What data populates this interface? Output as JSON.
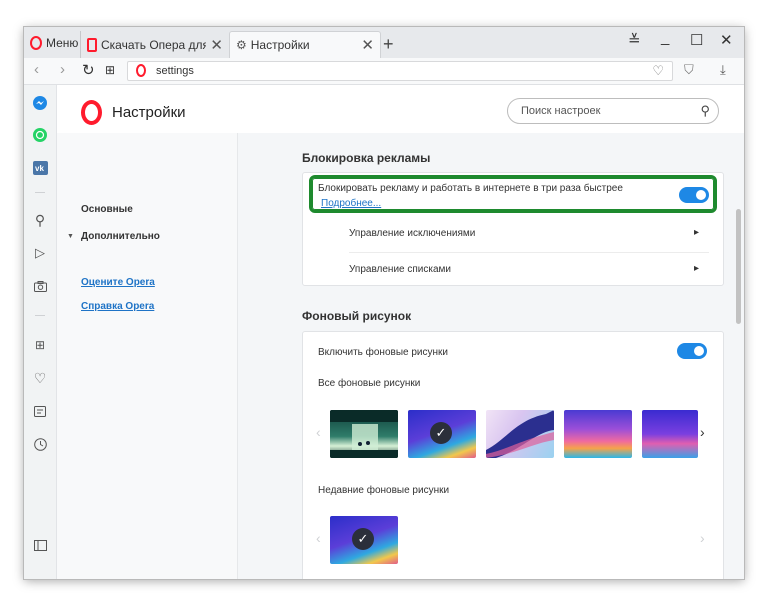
{
  "window": {
    "menu_label": "Меню",
    "tabs": [
      {
        "title": "Скачать Опера для компьютера",
        "icon": "opera-logo-icon"
      },
      {
        "title": "Настройки",
        "icon": "gear-icon"
      }
    ],
    "controls": [
      "tab-menu-icon",
      "minimize-icon",
      "maximize-icon",
      "close-icon"
    ]
  },
  "address_bar": {
    "url": "settings"
  },
  "sidebar": {
    "icons": [
      "messenger-icon",
      "whatsapp-icon",
      "vk-icon",
      "search-icon",
      "send-icon",
      "camera-icon",
      "speed-dial-icon",
      "heart-icon",
      "news-icon",
      "history-icon",
      "sidebar-toggle-icon"
    ]
  },
  "header": {
    "title": "Настройки",
    "search_placeholder": "Поиск настроек"
  },
  "left_nav": {
    "basic": "Основные",
    "advanced": "Дополнительно",
    "rate_link": "Оцените Opera",
    "help_link": "Справка Opera"
  },
  "adblock": {
    "section_title": "Блокировка рекламы",
    "toggle_text": "Блокировать рекламу и работать в интернете в три раза быстрее",
    "more_link": "Подробнее...",
    "enabled": true,
    "exceptions": "Управление исключениями",
    "lists": "Управление списками"
  },
  "wallpaper": {
    "section_title": "Фоновый рисунок",
    "toggle_text": "Включить фоновые рисунки",
    "enabled": true,
    "all_title": "Все фоновые рисунки",
    "recent_title": "Недавние фоновые рисунки"
  },
  "colors": {
    "accent": "#1e88e5",
    "highlight": "#1e8a2e",
    "opera_red": "#ff1b2d"
  }
}
